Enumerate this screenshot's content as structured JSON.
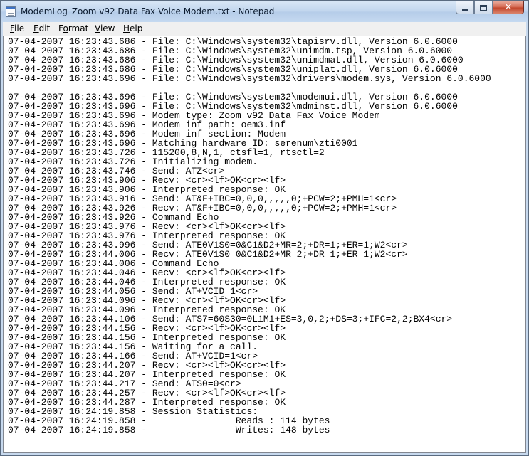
{
  "window": {
    "title": "ModemLog_Zoom v92 Data Fax Voice Modem.txt - Notepad",
    "controls": {
      "minimize": "minimize",
      "maximize": "maximize",
      "close": "close"
    }
  },
  "menu": [
    {
      "label": "File",
      "mnemonic": "F",
      "rest": "ile"
    },
    {
      "label": "Edit",
      "mnemonic": "E",
      "rest": "dit"
    },
    {
      "label": "Format",
      "mnemonic": "o",
      "pre": "F",
      "rest": "rmat"
    },
    {
      "label": "View",
      "mnemonic": "V",
      "rest": "iew"
    },
    {
      "label": "Help",
      "mnemonic": "H",
      "rest": "elp"
    }
  ],
  "lines": [
    "07-04-2007 16:23:43.686 - File: C:\\Windows\\system32\\tapisrv.dll, Version 6.0.6000",
    "07-04-2007 16:23:43.686 - File: C:\\Windows\\system32\\unimdm.tsp, Version 6.0.6000",
    "07-04-2007 16:23:43.686 - File: C:\\Windows\\system32\\unimdmat.dll, Version 6.0.6000",
    "07-04-2007 16:23:43.686 - File: C:\\Windows\\system32\\uniplat.dll, Version 6.0.6000",
    "07-04-2007 16:23:43.696 - File: C:\\Windows\\system32\\drivers\\modem.sys, Version 6.0.6000",
    "",
    "07-04-2007 16:23:43.696 - File: C:\\Windows\\system32\\modemui.dll, Version 6.0.6000",
    "07-04-2007 16:23:43.696 - File: C:\\Windows\\system32\\mdminst.dll, Version 6.0.6000",
    "07-04-2007 16:23:43.696 - Modem type: Zoom v92 Data Fax Voice Modem",
    "07-04-2007 16:23:43.696 - Modem inf path: oem3.inf",
    "07-04-2007 16:23:43.696 - Modem inf section: Modem",
    "07-04-2007 16:23:43.696 - Matching hardware ID: serenum\\zti0001",
    "07-04-2007 16:23:43.726 - 115200,8,N,1, ctsfl=1, rtsctl=2",
    "07-04-2007 16:23:43.726 - Initializing modem.",
    "07-04-2007 16:23:43.746 - Send: ATZ<cr>",
    "07-04-2007 16:23:43.906 - Recv: <cr><lf>OK<cr><lf>",
    "07-04-2007 16:23:43.906 - Interpreted response: OK",
    "07-04-2007 16:23:43.916 - Send: AT&F+IBC=0,0,0,,,,,0;+PCW=2;+PMH=1<cr>",
    "07-04-2007 16:23:43.926 - Recv: AT&F+IBC=0,0,0,,,,,0;+PCW=2;+PMH=1<cr>",
    "07-04-2007 16:23:43.926 - Command Echo",
    "07-04-2007 16:23:43.976 - Recv: <cr><lf>OK<cr><lf>",
    "07-04-2007 16:23:43.976 - Interpreted response: OK",
    "07-04-2007 16:23:43.996 - Send: ATE0V1S0=0&C1&D2+MR=2;+DR=1;+ER=1;W2<cr>",
    "07-04-2007 16:23:44.006 - Recv: ATE0V1S0=0&C1&D2+MR=2;+DR=1;+ER=1;W2<cr>",
    "07-04-2007 16:23:44.006 - Command Echo",
    "07-04-2007 16:23:44.046 - Recv: <cr><lf>OK<cr><lf>",
    "07-04-2007 16:23:44.046 - Interpreted response: OK",
    "07-04-2007 16:23:44.056 - Send: AT+VCID=1<cr>",
    "07-04-2007 16:23:44.096 - Recv: <cr><lf>OK<cr><lf>",
    "07-04-2007 16:23:44.096 - Interpreted response: OK",
    "07-04-2007 16:23:44.106 - Send: ATS7=60S30=0L1M1+ES=3,0,2;+DS=3;+IFC=2,2;BX4<cr>",
    "07-04-2007 16:23:44.156 - Recv: <cr><lf>OK<cr><lf>",
    "07-04-2007 16:23:44.156 - Interpreted response: OK",
    "07-04-2007 16:23:44.156 - Waiting for a call.",
    "07-04-2007 16:23:44.166 - Send: AT+VCID=1<cr>",
    "07-04-2007 16:23:44.207 - Recv: <cr><lf>OK<cr><lf>",
    "07-04-2007 16:23:44.207 - Interpreted response: OK",
    "07-04-2007 16:23:44.217 - Send: ATS0=0<cr>",
    "07-04-2007 16:23:44.257 - Recv: <cr><lf>OK<cr><lf>",
    "07-04-2007 16:23:44.287 - Interpreted response: OK",
    "07-04-2007 16:24:19.858 - Session Statistics:",
    "07-04-2007 16:24:19.858 -                Reads : 114 bytes",
    "07-04-2007 16:24:19.858 -                Writes: 148 bytes"
  ]
}
